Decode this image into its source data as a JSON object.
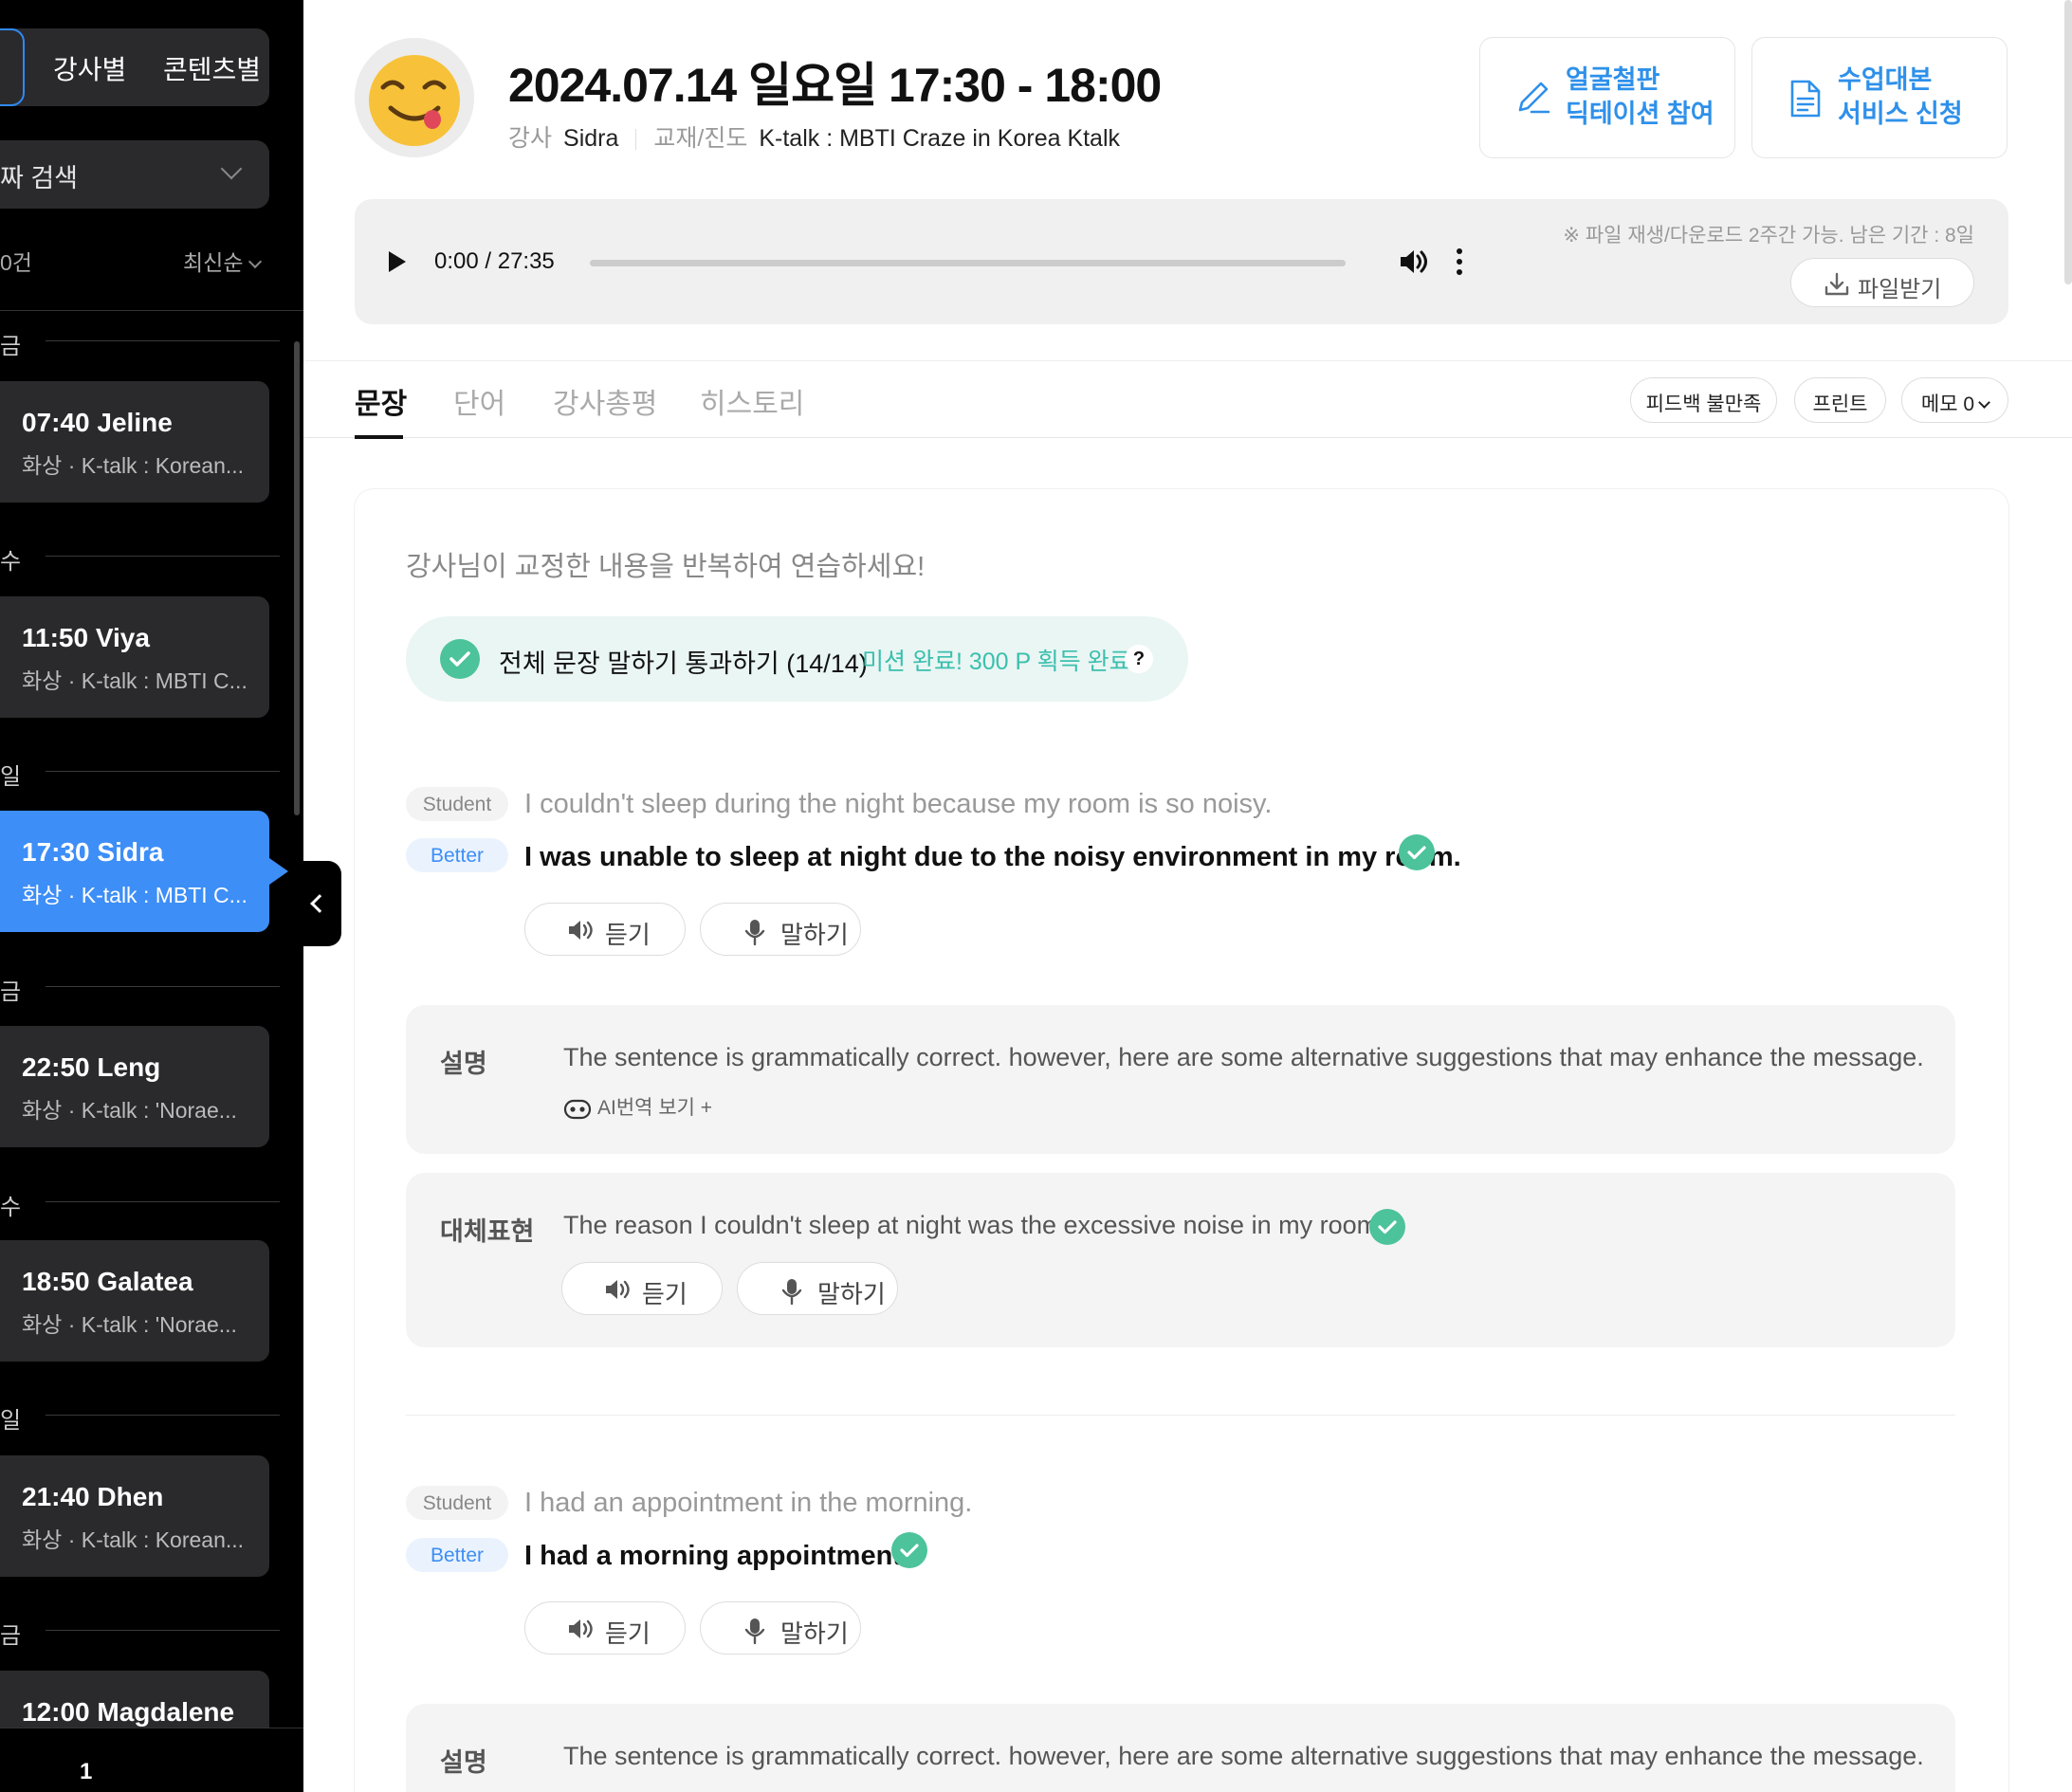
{
  "sidebar": {
    "tabs": [
      "강사별",
      "콘텐츠별"
    ],
    "date_search": "짜 검색",
    "count": "0건",
    "sort": "최신순",
    "days": [
      {
        "label": "금"
      },
      {
        "label": "수"
      },
      {
        "label": "일"
      },
      {
        "label": "금"
      },
      {
        "label": "수"
      },
      {
        "label": "일"
      },
      {
        "label": "금"
      }
    ],
    "lessons": [
      {
        "title": "07:40  Jeline",
        "sub": "화상 · K-talk : Korean..."
      },
      {
        "title": "11:50  Viya",
        "sub": "화상 · K-talk : MBTI C..."
      },
      {
        "title": "17:30  Sidra",
        "sub": "화상 · K-talk : MBTI C..."
      },
      {
        "title": "22:50  Leng",
        "sub": "화상 · K-talk : 'Norae..."
      },
      {
        "title": "18:50  Galatea",
        "sub": "화상 · K-talk : 'Norae..."
      },
      {
        "title": "21:40  Dhen",
        "sub": "화상 · K-talk : Korean..."
      },
      {
        "title": "12:00  Magdalene",
        "sub": ""
      }
    ],
    "page": "1"
  },
  "header": {
    "title": "2024.07.14 일요일  17:30 - 18:00",
    "teacher_label": "강사",
    "teacher": "Sidra",
    "material_label": "교재/진도",
    "material": "K-talk : MBTI Craze in Korea Ktalk",
    "btn1_line1": "얼굴철판",
    "btn1_line2": "딕테이션 참여",
    "btn2_line1": "수업대본",
    "btn2_line2": "서비스 신청"
  },
  "player": {
    "time": "0:00 / 27:35",
    "notice": "※ 파일 재생/다운로드 2주간 가능. 남은 기간 : 8일",
    "download": "파일받기",
    "progress": 0
  },
  "tabs": [
    "문장",
    "단어",
    "강사총평",
    "히스토리"
  ],
  "actions": {
    "feedback": "피드백 불만족",
    "print": "프린트",
    "memo": "메모 0"
  },
  "content": {
    "instruction": "강사님이 교정한 내용을 반복하여 연습하세요!",
    "mission_text": "전체 문장 말하기 통과하기 (14/14)",
    "mission_done": "미션 완료! 300 P 획득 완료",
    "mission_help": "?",
    "student_tag": "Student",
    "better_tag": "Better",
    "listen": "듣기",
    "speak": "말하기",
    "expl_label": "설명",
    "alt_label": "대체표현",
    "ai_view": "AI번역 보기 +",
    "items": [
      {
        "student": "I couldn't sleep during the night because my room is so noisy.",
        "better": "I was unable to sleep at night due to the noisy environment in my room.",
        "explanation": "The sentence is grammatically correct. however, here are some alternative suggestions that may enhance the message.",
        "alternative": "The reason I couldn't sleep at night was the excessive noise in my room."
      },
      {
        "student": "I had an appointment in the morning.",
        "better": "I had a morning appointment.",
        "explanation": "The sentence is grammatically correct. however, here are some alternative suggestions that may enhance the message."
      }
    ]
  },
  "colors": {
    "accent": "#3d8ef7",
    "mission_green": "#3bbfae",
    "check_green": "#4cc39a",
    "link_blue": "#2e90ea"
  }
}
